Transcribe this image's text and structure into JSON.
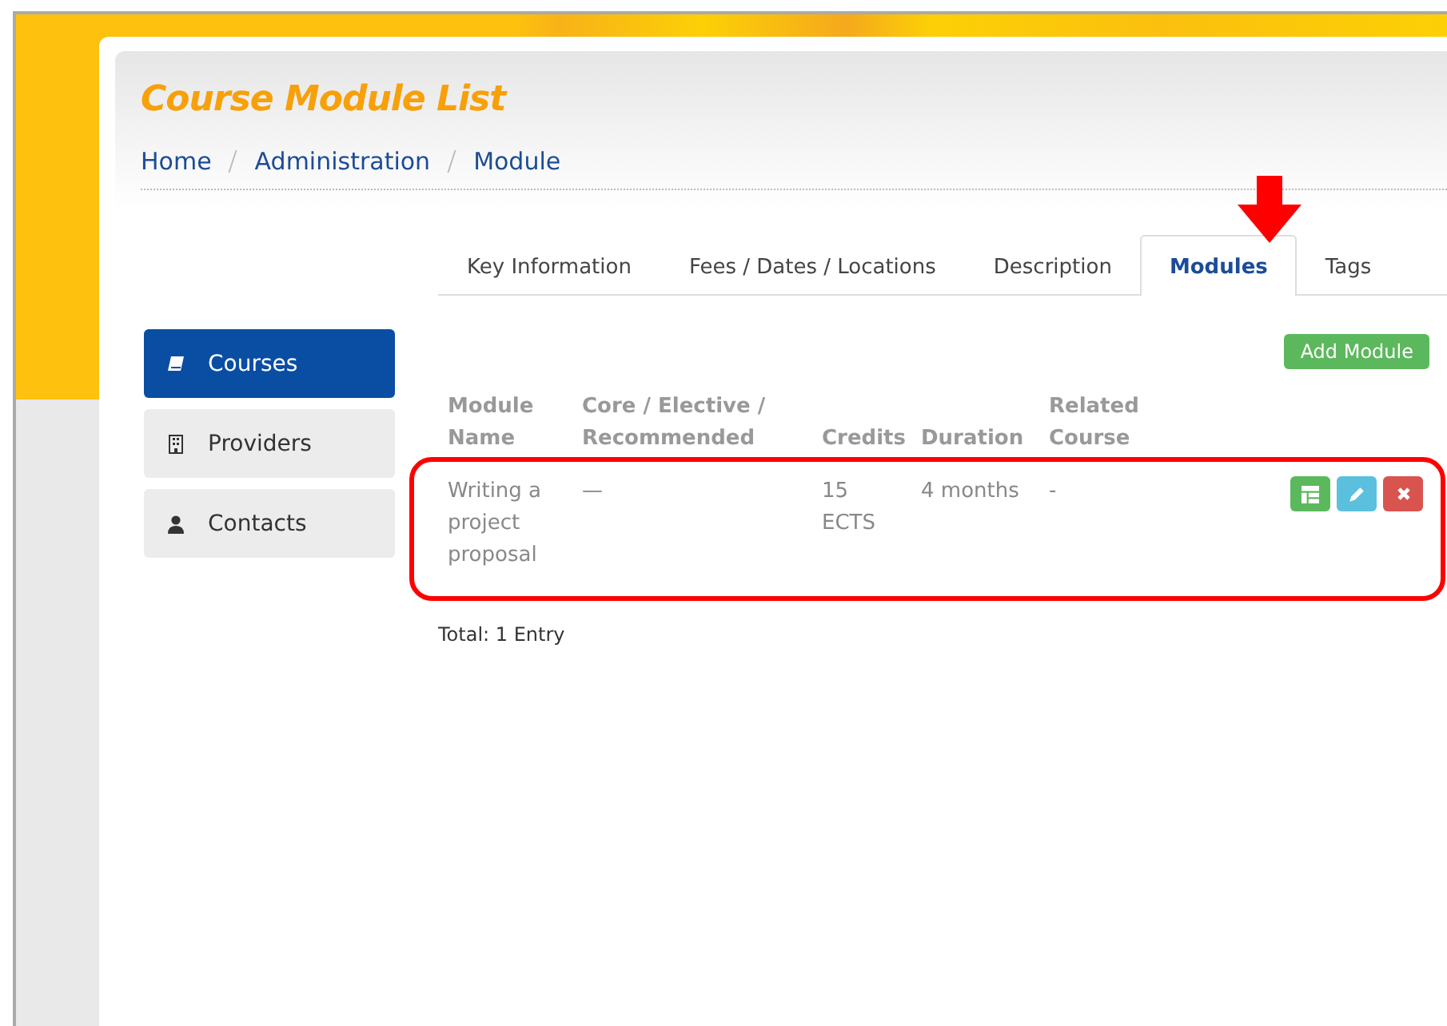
{
  "page": {
    "title": "Course Module List"
  },
  "breadcrumbs": [
    {
      "label": "Home"
    },
    {
      "label": "Administration"
    },
    {
      "label": "Module"
    }
  ],
  "tabs": [
    {
      "label": "Key Information",
      "selected": false
    },
    {
      "label": "Fees / Dates / Locations",
      "selected": false
    },
    {
      "label": "Description",
      "selected": false
    },
    {
      "label": "Modules",
      "selected": true
    },
    {
      "label": "Tags",
      "selected": false
    }
  ],
  "sidebar": {
    "items": [
      {
        "label": "Courses",
        "kind": "book",
        "selected": true
      },
      {
        "label": "Providers",
        "kind": "building",
        "selected": false
      },
      {
        "label": "Contacts",
        "kind": "user",
        "selected": false
      }
    ]
  },
  "add_button": "Add Module",
  "table": {
    "columns": [
      "Module Name",
      "Core / Elective / Recommended",
      "Credits",
      "Duration",
      "Related Course"
    ],
    "rows": [
      {
        "cells": [
          "Writing a project proposal",
          "—",
          "15 ECTS",
          "4 months",
          "-"
        ],
        "highlighted": true
      }
    ]
  },
  "total": "Total: 1 Entry"
}
